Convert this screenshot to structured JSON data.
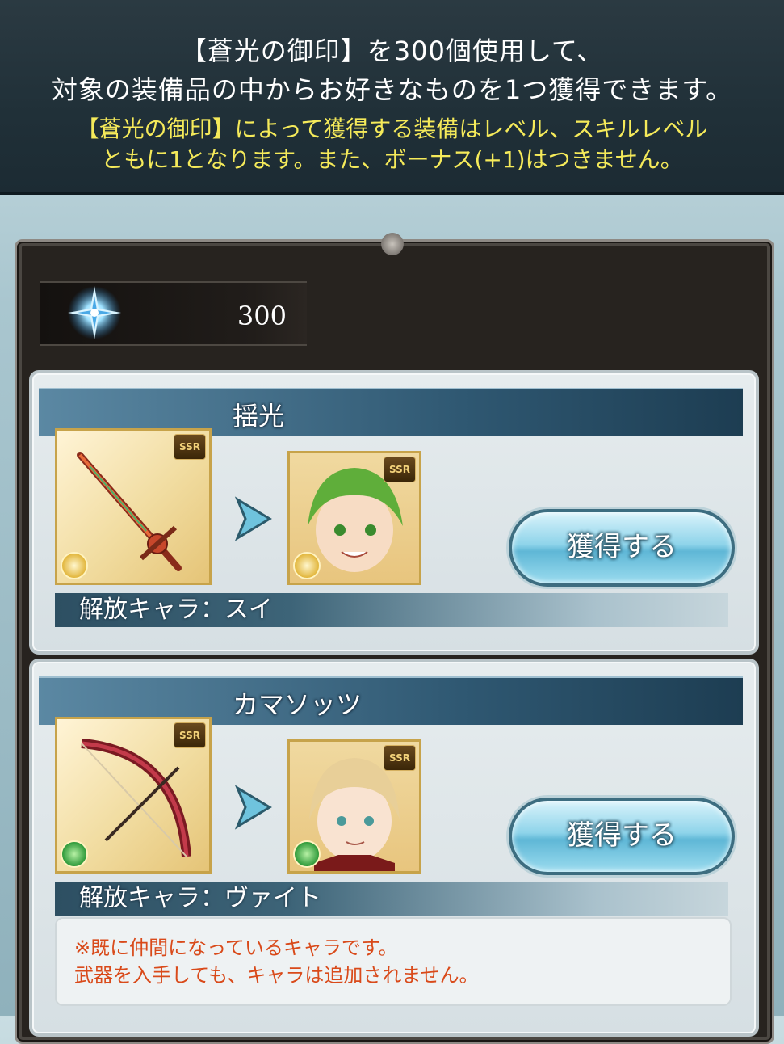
{
  "header": {
    "line1": "【蒼光の御印】を300個使用して、",
    "line2": "対象の装備品の中からお好きなものを1つ獲得できます。",
    "line3": "【蒼光の御印】によって獲得する装備はレベル、スキルレベル",
    "line4": "ともに1となります。また、ボーナス(+1)はつきません。"
  },
  "currency": {
    "icon": "blue-star-seal-icon",
    "count": "300"
  },
  "items": [
    {
      "name": "揺光",
      "rarity": "SSR",
      "element": "light",
      "weapon_icon": "sword-icon",
      "button_label": "獲得する",
      "release_label": "解放キャラ：スイ"
    },
    {
      "name": "カマソッツ",
      "rarity": "SSR",
      "element": "wind",
      "weapon_icon": "bow-icon",
      "button_label": "獲得する",
      "release_label": "解放キャラ：ヴァイト",
      "notice_line1": "※既に仲間になっているキャラです。",
      "notice_line2": "武器を入手しても、キャラは追加されません。"
    }
  ],
  "colors": {
    "header_bg": "#203038",
    "warning_yellow": "#f5ea5a",
    "notice_red": "#d94a1a",
    "button_blue": "#8fd4ea"
  }
}
